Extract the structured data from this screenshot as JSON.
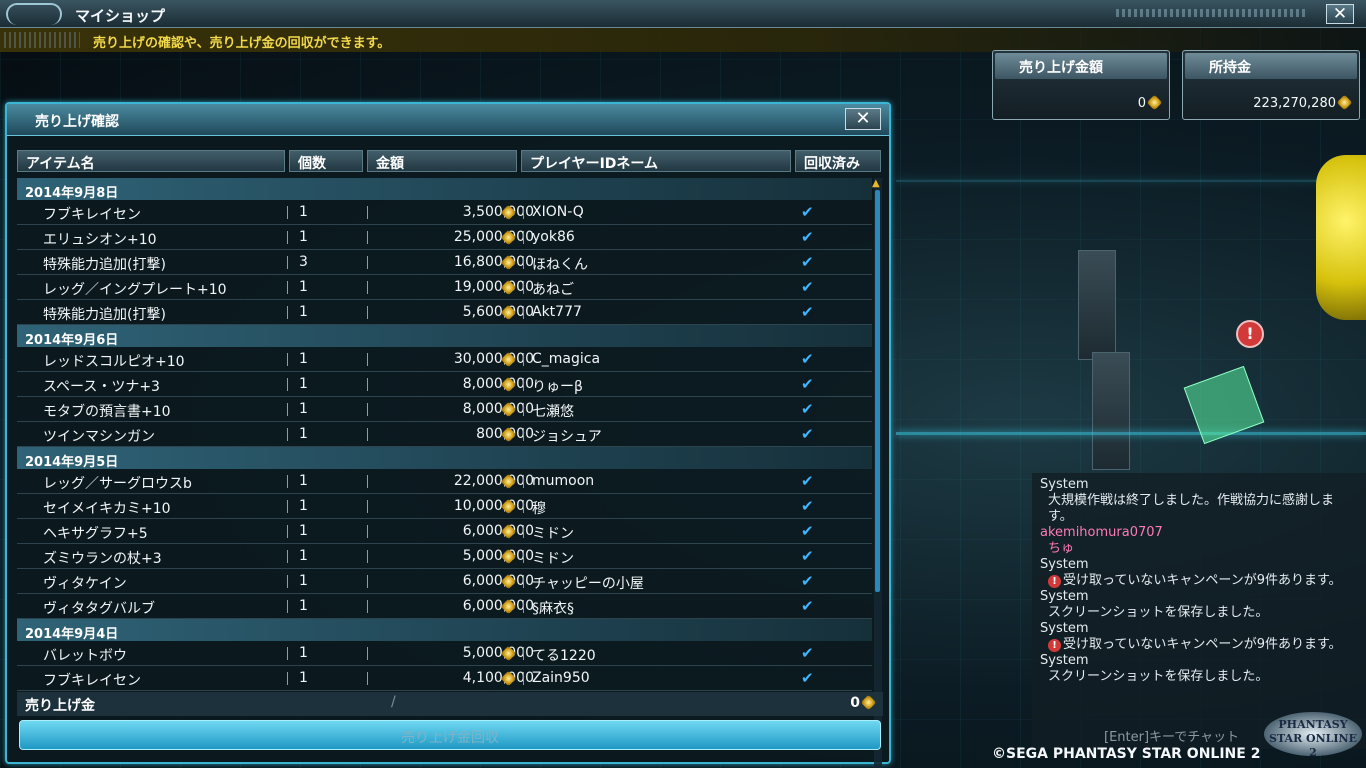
{
  "topbar": {
    "title": "マイショップ",
    "close_glyph": "✕"
  },
  "subbar": {
    "text": "売り上げの確認や、売り上げ金の回収ができます。"
  },
  "money": {
    "sales_label": "売り上げ金額",
    "sales_value": "0",
    "owned_label": "所持金",
    "owned_value": "223,270,280"
  },
  "panel": {
    "title": "売り上げ確認",
    "close_glyph": "✕",
    "columns": {
      "item": "アイテム名",
      "qty": "個数",
      "amount": "金額",
      "player": "プレイヤーIDネーム",
      "collected": "回収済み"
    },
    "groups": [
      {
        "date": "2014年9月8日",
        "rows": [
          {
            "name": "フブキレイセン",
            "qty": "1",
            "amount": "3,500,000",
            "player": "XION-Q"
          },
          {
            "name": "エリュシオン+10",
            "qty": "1",
            "amount": "25,000,000",
            "player": "yok86"
          },
          {
            "name": "特殊能力追加(打撃)",
            "qty": "3",
            "amount": "16,800,000",
            "player": "ほねくん"
          },
          {
            "name": "レッグ／イングプレート+10",
            "qty": "1",
            "amount": "19,000,000",
            "player": "あねご"
          },
          {
            "name": "特殊能力追加(打撃)",
            "qty": "1",
            "amount": "5,600,000",
            "player": "Akt777"
          }
        ]
      },
      {
        "date": "2014年9月6日",
        "rows": [
          {
            "name": "レッドスコルピオ+10",
            "qty": "1",
            "amount": "30,000,000",
            "player": "C_magica"
          },
          {
            "name": "スペース・ツナ+3",
            "qty": "1",
            "amount": "8,000,000",
            "player": "りゅーβ"
          },
          {
            "name": "モタブの預言書+10",
            "qty": "1",
            "amount": "8,000,000",
            "player": "七瀬悠"
          },
          {
            "name": "ツインマシンガン",
            "qty": "1",
            "amount": "800,000",
            "player": "ジョシュア"
          }
        ]
      },
      {
        "date": "2014年9月5日",
        "rows": [
          {
            "name": "レッグ／サーグロウスb",
            "qty": "1",
            "amount": "22,000,000",
            "player": "mumoon"
          },
          {
            "name": "セイメイキカミ+10",
            "qty": "1",
            "amount": "10,000,000",
            "player": "穆"
          },
          {
            "name": "ヘキサグラフ+5",
            "qty": "1",
            "amount": "6,000,000",
            "player": "ミドン"
          },
          {
            "name": "ズミウランの杖+3",
            "qty": "1",
            "amount": "5,000,000",
            "player": "ミドン"
          },
          {
            "name": "ヴィタケイン",
            "qty": "1",
            "amount": "6,000,000",
            "player": "チャッピーの小屋"
          },
          {
            "name": "ヴィタタグバルブ",
            "qty": "1",
            "amount": "6,000,000",
            "player": "§麻衣§"
          }
        ]
      },
      {
        "date": "2014年9月4日",
        "rows": [
          {
            "name": "バレットボウ",
            "qty": "1",
            "amount": "5,000,000",
            "player": "てる1220"
          },
          {
            "name": "フブキレイセン",
            "qty": "1",
            "amount": "4,100,000",
            "player": "Zain950"
          }
        ]
      }
    ],
    "total_label": "売り上げ金",
    "total_value": "0",
    "collect_button": "売り上げ金回収"
  },
  "chat": [
    {
      "who": "System",
      "msg": "大規模作戦は終了しました。作戦協力に感謝します。",
      "pink": false,
      "warn": false
    },
    {
      "who": "akemihomura0707",
      "msg": "ちゅ",
      "pink": true,
      "warn": false
    },
    {
      "who": "System",
      "msg": "受け取っていないキャンペーンが9件あります。",
      "pink": false,
      "warn": true
    },
    {
      "who": "System",
      "msg": "スクリーンショットを保存しました。",
      "pink": false,
      "warn": false
    },
    {
      "who": "System",
      "msg": "受け取っていないキャンペーンが9件あります。",
      "pink": false,
      "warn": true
    },
    {
      "who": "System",
      "msg": "スクリーンショットを保存しました。",
      "pink": false,
      "warn": false
    }
  ],
  "chat_hint": "[Enter]キーでチャット",
  "logo_text": "PHANTASY STAR ONLINE 2",
  "copyright": "©SEGA PHANTASY STAR ONLINE 2",
  "icons": {
    "meseta": "meseta-coin-icon",
    "check": "checkmark-icon",
    "warning": "warning-icon"
  },
  "colors": {
    "accent": "#3bb5d4",
    "check": "#3fb4ff",
    "notice": "#f2d84a",
    "chat_pink": "#ff7ab8"
  }
}
